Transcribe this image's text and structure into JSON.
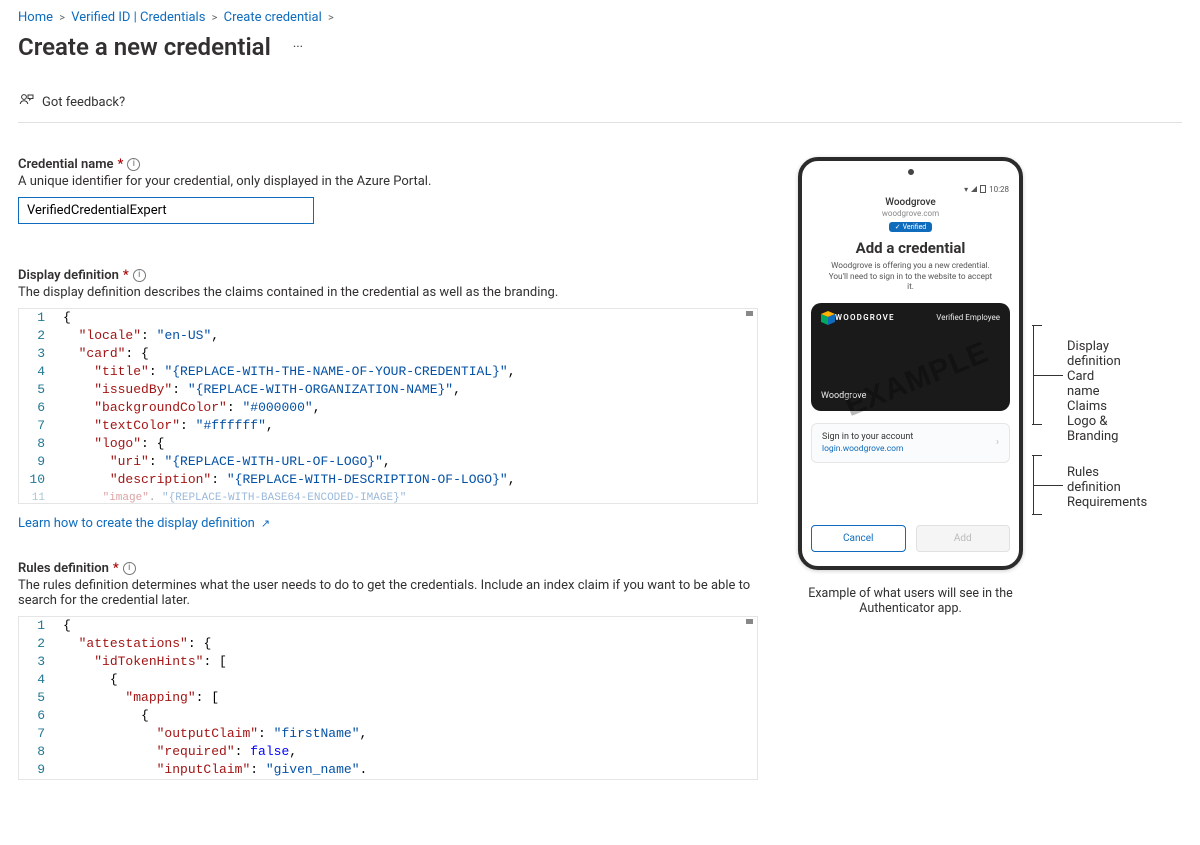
{
  "breadcrumb": {
    "items": [
      "Home",
      "Verified ID | Credentials",
      "Create credential"
    ],
    "trailing": true
  },
  "page_title": "Create a new credential",
  "feedback_label": "Got feedback?",
  "cred_name": {
    "label": "Credential name",
    "desc": "A unique identifier for your credential, only displayed in the Azure Portal.",
    "value": "VerifiedCredentialExpert"
  },
  "display_def": {
    "label": "Display definition",
    "desc": "The display definition describes the claims contained in the credential as well as the branding.",
    "learn_link": "Learn how to create the display definition"
  },
  "rules_def": {
    "label": "Rules definition",
    "desc": "The rules definition determines what the user needs to do to get the credentials. Include an index claim if you want to be able to search for the credential later."
  },
  "display_json": {
    "locale": "en-US",
    "card": {
      "title": "{REPLACE-WITH-THE-NAME-OF-YOUR-CREDENTIAL}",
      "issuedBy": "{REPLACE-WITH-ORGANIZATION-NAME}",
      "backgroundColor": "#000000",
      "textColor": "#ffffff",
      "logo": {
        "uri": "{REPLACE-WITH-URL-OF-LOGO}",
        "description": "{REPLACE-WITH-DESCRIPTION-OF-LOGO}",
        "image_truncated": "{REPLACE-WITH-BASE64-ENCODED-IMAGE}"
      }
    }
  },
  "rules_json_partial": {
    "outputClaim": "firstName",
    "required_literal": "false",
    "inputClaim": "given_name"
  },
  "phone_preview": {
    "time": "10:28",
    "site_title": "Woodgrove",
    "site_url": "woodgrove.com",
    "verified_badge": "Verified",
    "h1": "Add a credential",
    "desc": "Woodgrove is offering you a new credential. You'll need to sign in to the website to accept it.",
    "card": {
      "brand": "WOODGROVE",
      "role": "Verified Employee",
      "issuer": "Woodgrove"
    },
    "signin": {
      "title": "Sign in to your account",
      "url": "login.woodgrove.com"
    },
    "buttons": {
      "cancel": "Cancel",
      "add": "Add"
    },
    "caption": "Example of what users will see in the Authenticator app."
  },
  "annotations": {
    "display": {
      "head": "Display definition",
      "items": [
        "Card name",
        "Claims",
        "Logo & Branding"
      ]
    },
    "rules": {
      "head": "Rules definition",
      "items": [
        "Requirements"
      ]
    }
  }
}
